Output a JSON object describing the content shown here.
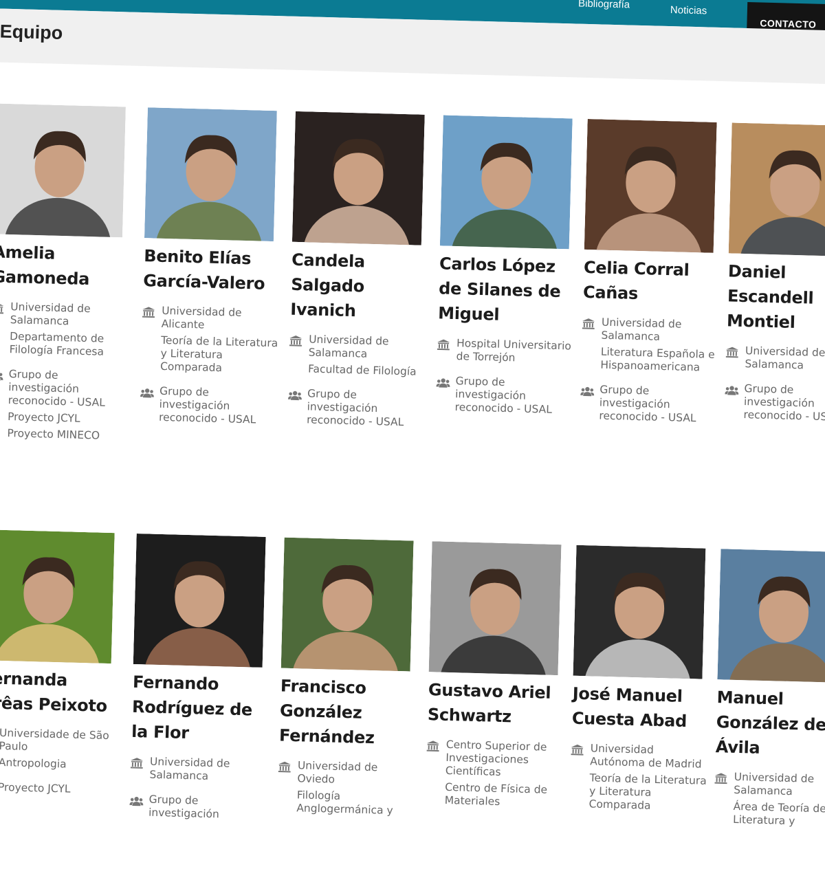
{
  "nav": {
    "items": [
      "Bibliografía",
      "Noticias"
    ],
    "cta": "CONTACTO"
  },
  "page": {
    "title": "Equipo"
  },
  "members": [
    {
      "name": "Amelia Gamoneda",
      "institution": [
        "Universidad de Salamanca",
        "Departamento de Filología Francesa"
      ],
      "groups": [
        "Grupo de investigación reconocido - USAL",
        "Proyecto JCYL",
        "Proyecto MINECO"
      ]
    },
    {
      "name": "Benito Elías García-Valero",
      "institution": [
        "Universidad de Alicante",
        "Teoría de la Literatura y Literatura Comparada"
      ],
      "groups": [
        "Grupo de investigación reconocido - USAL"
      ]
    },
    {
      "name": "Candela Salgado Ivanich",
      "institution": [
        "Universidad de Salamanca",
        "Facultad de Filología"
      ],
      "groups": [
        "Grupo de investigación reconocido - USAL"
      ]
    },
    {
      "name": "Carlos López de Silanes de Miguel",
      "institution": [
        "Hospital Universitario de Torrejón"
      ],
      "groups": [
        "Grupo de investigación reconocido - USAL"
      ]
    },
    {
      "name": "Celia Corral Cañas",
      "institution": [
        "Universidad de Salamanca",
        "Literatura Española e Hispanoamericana"
      ],
      "groups": [
        "Grupo de investigación reconocido - USAL"
      ]
    },
    {
      "name": "Daniel Escandell Montiel",
      "institution": [
        "Universidad de Salamanca"
      ],
      "groups": [
        "Grupo de investigación reconocido - USAL"
      ]
    },
    {
      "name": "Fernanda Arêas Peixoto",
      "institution": [
        "Universidade de São Paulo",
        "Antropologia"
      ],
      "groups": [
        "Proyecto JCYL"
      ]
    },
    {
      "name": "Fernando Rodríguez de la Flor",
      "institution": [
        "Universidad de Salamanca"
      ],
      "groups": [
        "Grupo de investigación"
      ]
    },
    {
      "name": "Francisco González Fernández",
      "institution": [
        "Universidad de Oviedo",
        "Filología Anglogermánica y"
      ],
      "groups": []
    },
    {
      "name": "Gustavo Ariel Schwartz",
      "institution": [
        "Centro Superior de Investigaciones Científicas",
        "Centro de Física de Materiales"
      ],
      "groups": []
    },
    {
      "name": "José Manuel Cuesta Abad",
      "institution": [
        "Universidad Autónoma de Madrid",
        "Teoría de la Literatura y Literatura Comparada"
      ],
      "groups": []
    },
    {
      "name": "Manuel González de Ávila",
      "institution": [
        "Universidad de Salamanca",
        "Área de Teoría de la Literatura y"
      ],
      "groups": []
    }
  ]
}
